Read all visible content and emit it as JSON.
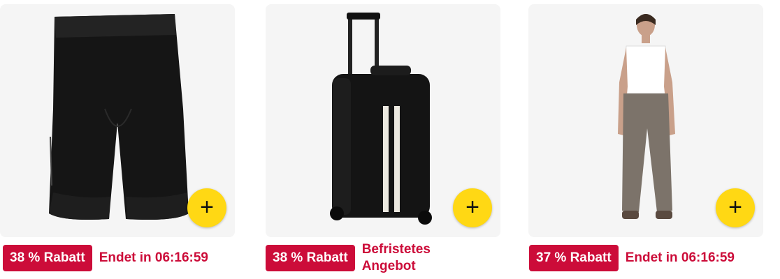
{
  "products": [
    {
      "image_icon": "cycling-shorts-image",
      "discount_label": "38 % Rabatt",
      "deal_text": "Endet in 06:16:59",
      "add_button_symbol": "+"
    },
    {
      "image_icon": "rolling-suitcase-image",
      "discount_label": "38 % Rabatt",
      "deal_text": "Befristetes Angebot",
      "add_button_symbol": "+"
    },
    {
      "image_icon": "woman-in-trousers-image",
      "discount_label": "37 % Rabatt",
      "deal_text": "Endet in 06:16:59",
      "add_button_symbol": "+"
    }
  ],
  "colors": {
    "badge_bg": "#cc0c39",
    "add_button": "#ffd814",
    "image_bg": "#f5f5f5"
  }
}
